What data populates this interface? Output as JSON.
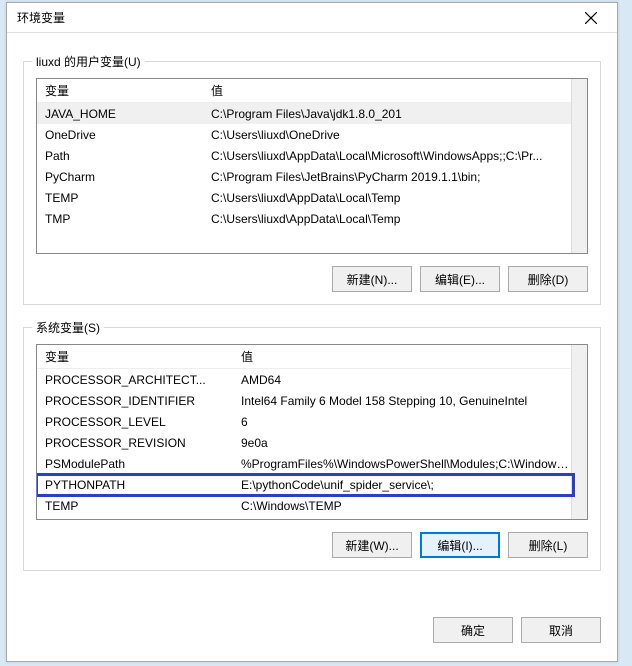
{
  "window": {
    "title": "环境变量"
  },
  "user_section": {
    "label": "liuxd 的用户变量(U)",
    "headers": {
      "variable": "变量",
      "value": "值"
    },
    "rows": [
      {
        "name": "JAVA_HOME",
        "value": "C:\\Program Files\\Java\\jdk1.8.0_201",
        "selected": true
      },
      {
        "name": "OneDrive",
        "value": "C:\\Users\\liuxd\\OneDrive"
      },
      {
        "name": "Path",
        "value": "C:\\Users\\liuxd\\AppData\\Local\\Microsoft\\WindowsApps;;C:\\Pr..."
      },
      {
        "name": "PyCharm",
        "value": "C:\\Program Files\\JetBrains\\PyCharm 2019.1.1\\bin;"
      },
      {
        "name": "TEMP",
        "value": "C:\\Users\\liuxd\\AppData\\Local\\Temp"
      },
      {
        "name": "TMP",
        "value": "C:\\Users\\liuxd\\AppData\\Local\\Temp"
      }
    ],
    "buttons": {
      "new": "新建(N)...",
      "edit": "编辑(E)...",
      "delete": "删除(D)"
    }
  },
  "system_section": {
    "label": "系统变量(S)",
    "headers": {
      "variable": "变量",
      "value": "值"
    },
    "rows": [
      {
        "name": "PROCESSOR_ARCHITECT...",
        "value": "AMD64"
      },
      {
        "name": "PROCESSOR_IDENTIFIER",
        "value": "Intel64 Family 6 Model 158 Stepping 10, GenuineIntel"
      },
      {
        "name": "PROCESSOR_LEVEL",
        "value": "6"
      },
      {
        "name": "PROCESSOR_REVISION",
        "value": "9e0a"
      },
      {
        "name": "PSModulePath",
        "value": "%ProgramFiles%\\WindowsPowerShell\\Modules;C:\\Windows\\..."
      },
      {
        "name": "PYTHONPATH",
        "value": "E:\\pythonCode\\unif_spider_service\\;",
        "highlighted": true
      },
      {
        "name": "TEMP",
        "value": "C:\\Windows\\TEMP"
      }
    ],
    "buttons": {
      "new": "新建(W)...",
      "edit": "编辑(I)...",
      "delete": "删除(L)"
    }
  },
  "footer": {
    "ok": "确定",
    "cancel": "取消"
  }
}
